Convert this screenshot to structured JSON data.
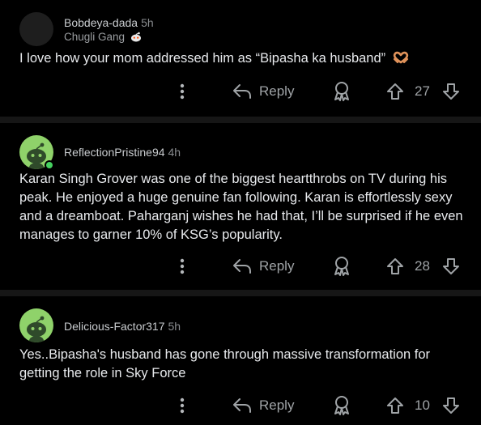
{
  "comments": [
    {
      "username": "Bobdeya-dada",
      "time": "5h",
      "flair": "Chugli Gang",
      "text": "I love how your mom addressed him as “Bipasha ka husband”",
      "reply_label": "Reply",
      "votes": "27",
      "avatar": "blank"
    },
    {
      "username": "ReflectionPristine94",
      "time": "4h",
      "text": "Karan Singh Grover was one of the biggest heartthrobs on TV during his peak. He enjoyed a huge genuine fan following. Karan is effortlessly sexy and a dreamboat. Paharganj wishes he had that, I’ll be surprised if he even manages to garner 10% of KSG’s popularity.",
      "reply_label": "Reply",
      "votes": "28",
      "avatar": "snoo-green"
    },
    {
      "username": "Delicious-Factor317",
      "time": "5h",
      "text": "Yes..Bipasha's husband has gone through massive transformation for getting the role in Sky Force",
      "reply_label": "Reply",
      "votes": "10",
      "avatar": "snoo-green"
    }
  ],
  "colors": {
    "background": "#000000",
    "separator": "#161616",
    "avatar_green": "#8fd26a",
    "online_dot": "#46d160",
    "emoji_heart_hands": "#e0925a"
  },
  "icons": {
    "more": "vertical-ellipsis-icon",
    "reply": "reply-arrow-icon",
    "award": "award-icon",
    "upvote": "upvote-arrow-icon",
    "downvote": "downvote-arrow-icon",
    "flair_emoji": "snoo-face-icon",
    "text_emoji": "heart-hands-emoji"
  }
}
